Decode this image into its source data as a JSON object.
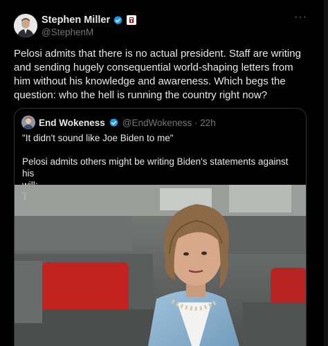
{
  "author": {
    "name": "Stephen Miller",
    "handle": "@StephenM"
  },
  "tweet": {
    "text_line1": "Pelosi admits that there is no actual president. Staff are writing",
    "text_line2": "and sending hugely consequential world-shaping letters from",
    "text_line3": "him without his knowledge and awareness. Which begs the",
    "text_line4": "question: who the hell is running the country right now?"
  },
  "quoted": {
    "name": "End Wokeness",
    "handle": "@EndWokeness · 22h",
    "line1": "\"It didn't sound like Joe Biden to me\"",
    "line2": "Pelosi admits others might be writing Biden's statements against his",
    "line3": "will:",
    "image_watermark": "T"
  },
  "icons": {
    "more": "more-options-icon",
    "verified": "verified-badge-icon",
    "affiliation": "affiliation-badge-icon"
  },
  "colors": {
    "background": "#000000",
    "text": "#e7e9ea",
    "secondary": "#71767b",
    "verified_blue": "#1d9bf0",
    "border": "#2f3336"
  }
}
